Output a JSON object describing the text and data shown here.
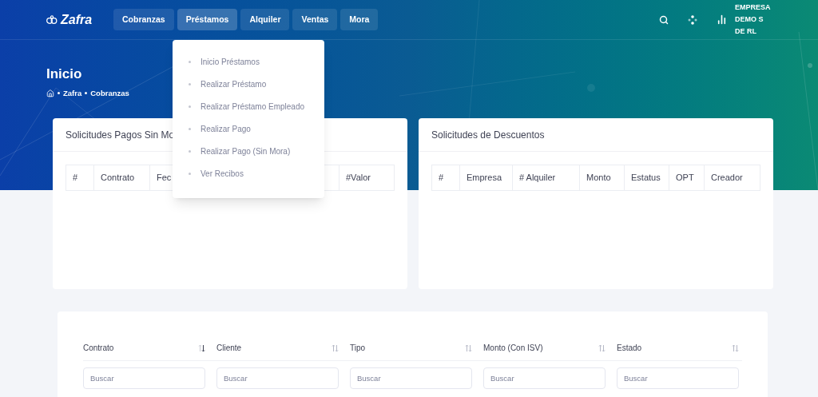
{
  "brand": "Zafra",
  "nav": [
    {
      "label": "Cobranzas",
      "selected": false
    },
    {
      "label": "Préstamos",
      "selected": true
    },
    {
      "label": "Alquiler",
      "selected": false
    },
    {
      "label": "Ventas",
      "selected": false
    },
    {
      "label": "Mora",
      "selected": false
    }
  ],
  "company": "EMPRESA DEMO S DE RL",
  "dropdown": [
    "Inicio Préstamos",
    "Realizar Préstamo",
    "Realizar Préstamo Empleado",
    "Realizar Pago",
    "Realizar Pago (Sin Mora)",
    "Ver Recibos"
  ],
  "page_title": "Inicio",
  "breadcrumb": [
    "Zafra",
    "Cobranzas"
  ],
  "cards": [
    {
      "title": "Solicitudes Pagos Sin Mo",
      "columns": [
        "#",
        "Contrato",
        "Fec",
        "#Valor"
      ]
    },
    {
      "title": "Solicitudes de Descuentos",
      "columns": [
        "#",
        "Empresa",
        "# Alquiler",
        "Monto",
        "Estatus",
        "OPT",
        "Creador"
      ]
    }
  ],
  "table": {
    "columns": [
      {
        "label": "Contrato",
        "sorted": true,
        "placeholder": "Buscar"
      },
      {
        "label": "Cliente",
        "sorted": false,
        "placeholder": "Buscar"
      },
      {
        "label": "Tipo",
        "sorted": false,
        "placeholder": "Buscar"
      },
      {
        "label": "Monto (Con ISV)",
        "sorted": false,
        "placeholder": "Buscar"
      },
      {
        "label": "Estado",
        "sorted": false,
        "placeholder": "Buscar"
      }
    ]
  }
}
